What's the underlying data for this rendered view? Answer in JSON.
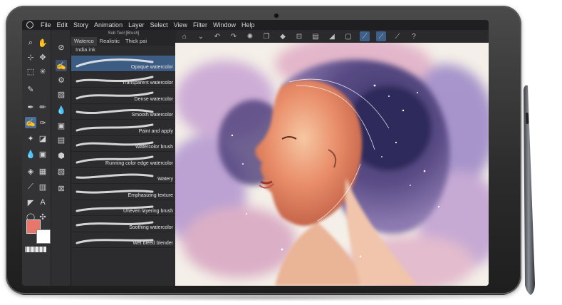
{
  "menu": {
    "items": [
      "File",
      "Edit",
      "Story",
      "Animation",
      "Layer",
      "Select",
      "View",
      "Filter",
      "Window",
      "Help"
    ]
  },
  "panel": {
    "title": "Sub Tool [Brush]",
    "tabs": [
      "Waterco",
      "Realistic",
      "Thick pai"
    ],
    "subtab": "India ink",
    "brushes": [
      {
        "name": "Opaque watercolor",
        "selected": true
      },
      {
        "name": "Transparent watercolor",
        "selected": false
      },
      {
        "name": "Dense watercolor",
        "selected": false
      },
      {
        "name": "Smooth watercolor",
        "selected": false
      },
      {
        "name": "Paint and apply",
        "selected": false
      },
      {
        "name": "Watercolor brush",
        "selected": false
      },
      {
        "name": "Running color edge watercolor",
        "selected": false
      },
      {
        "name": "Watery",
        "selected": false
      },
      {
        "name": "Emphasizing texture",
        "selected": false
      },
      {
        "name": "Uneven layering brush",
        "selected": false
      },
      {
        "name": "Soothing watercolor",
        "selected": false
      },
      {
        "name": "Wet bleed blender",
        "selected": false
      }
    ]
  },
  "colors": {
    "main_color": "#e8766a",
    "sub_color": "#ffffff",
    "accent": "#3c5c84"
  }
}
